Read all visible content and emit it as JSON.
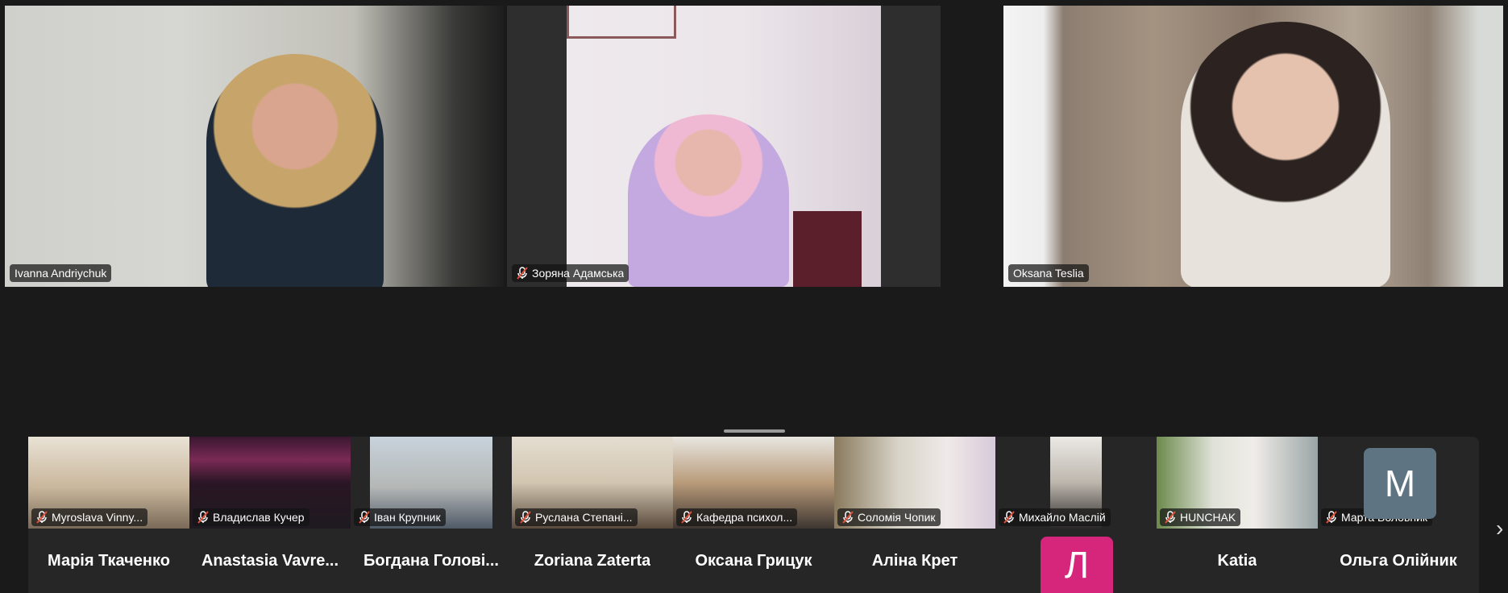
{
  "main_tiles": [
    {
      "name": "Ivanna Andriychuk",
      "muted": false,
      "active": false
    },
    {
      "name": "Зоряна Адамська",
      "muted": true,
      "active": false
    },
    {
      "name": "Oksana Teslia",
      "muted": false,
      "active": true
    }
  ],
  "strip_video_tiles": [
    {
      "name": "Myroslava Vinny...",
      "muted": true
    },
    {
      "name": "Владислав Кучер",
      "muted": true
    },
    {
      "name": "Іван Крупник",
      "muted": true
    },
    {
      "name": "Руслана Степані...",
      "muted": true
    },
    {
      "name": "Кафедра психол...",
      "muted": true
    },
    {
      "name": "Соломія Чопик",
      "muted": true
    },
    {
      "name": "Михайло Маслій",
      "muted": true
    },
    {
      "name": "HUNCHAK",
      "muted": true
    },
    {
      "name": "Марта Воловник",
      "muted": true
    }
  ],
  "strip_audio_names": [
    "Марія Ткаченко",
    "Anastasia  Vavre...",
    "Богдана  Голові...",
    "Zoriana Zaterta",
    "Оксана Грицук",
    "Аліна Крет",
    "",
    "Katia",
    "Ольга Олійник"
  ],
  "avatars": {
    "marta_initial": "M",
    "l_initial": "Л"
  },
  "icons": {
    "muted": "mic-off-icon",
    "next": "chevron-right-icon"
  },
  "colors": {
    "active_border": "#3ce0b0",
    "muted_icon": "#e0503c",
    "avatar_m": "#5e7482",
    "avatar_l": "#d6267b"
  }
}
